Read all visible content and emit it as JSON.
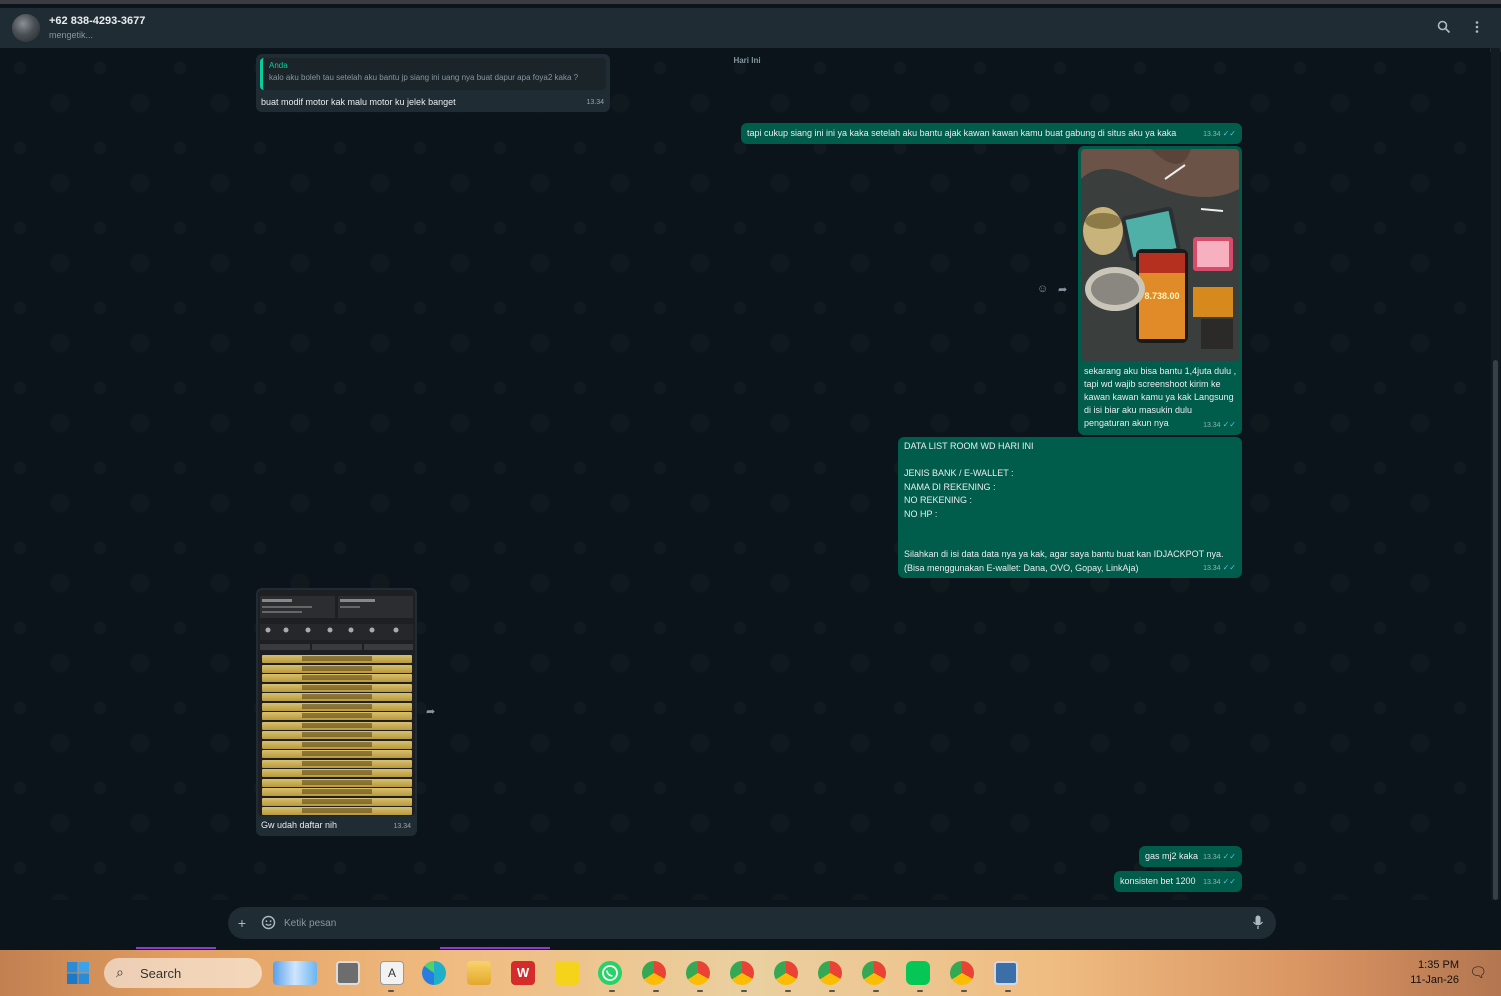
{
  "header": {
    "contact_name": "+62 838-4293-3677",
    "contact_status": "mengetik..."
  },
  "chat": {
    "day_label": "Hari Ini",
    "messages": [
      {
        "direction": "in",
        "quote_author": "Anda",
        "quote_text": "kalo aku boleh tau setelah aku bantu jp siang ini uang nya buat dapur apa foya2 kaka ?",
        "text": "buat modif motor kak malu motor ku jelek banget",
        "time": "13.34"
      },
      {
        "direction": "out",
        "text": "tapi cukup siang ini ini ya kaka setelah aku bantu ajak kawan kawan kamu buat gabung di situs aku ya kaka",
        "time": "13.34",
        "status": "read"
      },
      {
        "direction": "out",
        "type": "image",
        "image_text": "8.738.00",
        "caption": "sekarang aku bisa bantu 1,4juta dulu , tapi wd wajib screenshoot kirim ke kawan kawan kamu ya kak Langsung di isi biar aku masukin dulu pengaturan akun nya",
        "time": "13.34",
        "status": "read"
      },
      {
        "direction": "out",
        "lines": [
          "DATA LIST ROOM WD HARI INI",
          "",
          "JENIS BANK / E-WALLET :",
          "NAMA DI REKENING :",
          "NO REKENING :",
          "NO HP :",
          "",
          "",
          "Silahkan di isi data data nya ya kak, agar saya bantu buat kan IDJACKPOT nya.",
          "(Bisa menggunakan E-wallet: Dana, OVO, Gopay, LinkAja)"
        ],
        "time": "13.34",
        "status": "read"
      },
      {
        "direction": "in",
        "type": "image",
        "caption": "Gw udah daftar nih",
        "time": "13.34"
      },
      {
        "direction": "out",
        "text": "gas mj2 kaka",
        "time": "13.34",
        "status": "read"
      },
      {
        "direction": "out",
        "text": "konsisten bet 1200",
        "time": "13.34",
        "status": "read"
      }
    ]
  },
  "composer": {
    "placeholder": "Ketik pesan"
  },
  "taskbar": {
    "search_label": "Search",
    "time": "1:35 PM",
    "date": "11-Jan-26"
  },
  "colors": {
    "outgoing_bubble": "#005c4b",
    "incoming_bubble": "#202c33",
    "chat_background": "#0b141a",
    "accent": "#06cf9c",
    "read_tick": "#53bdeb"
  }
}
